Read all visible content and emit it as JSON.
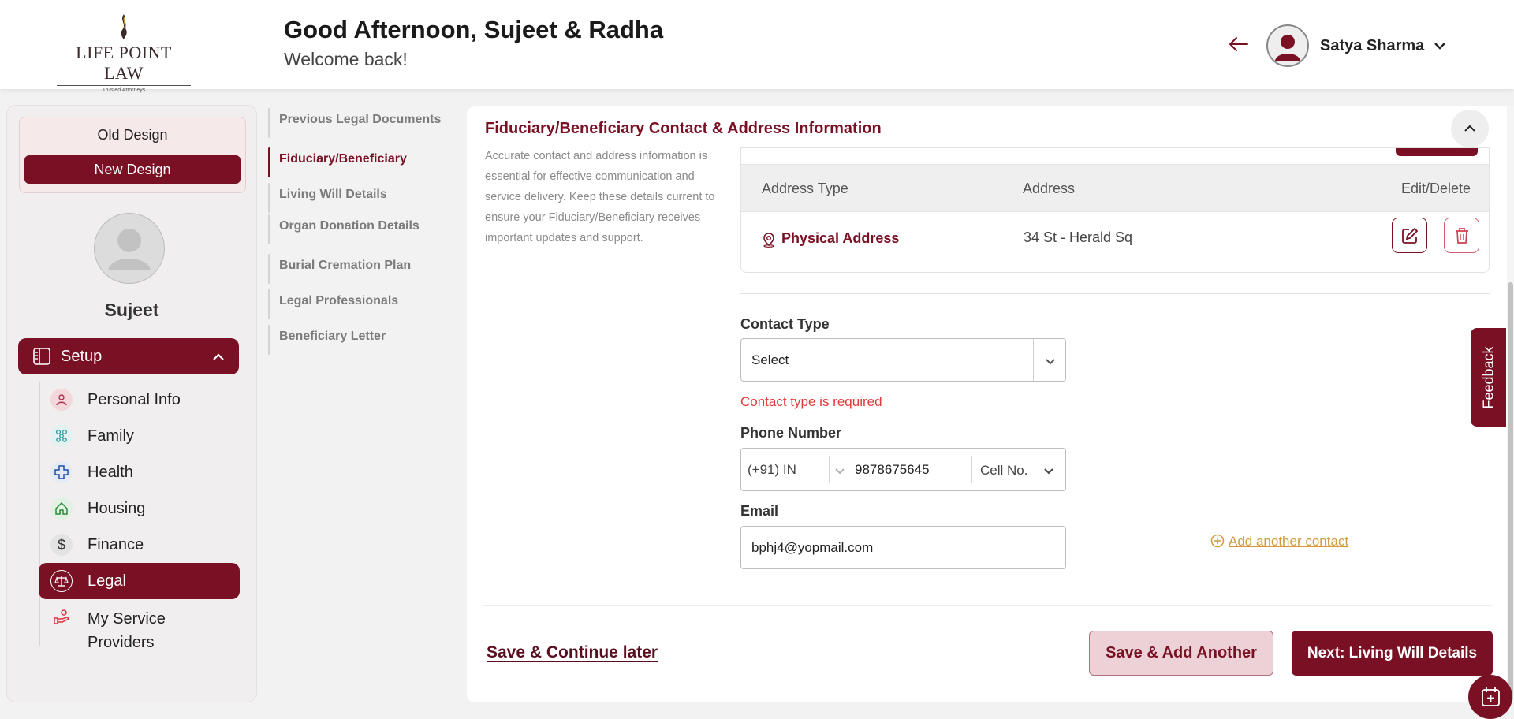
{
  "header": {
    "logo_name": "LIFE POINT LAW",
    "logo_tagline": "Trusted Attorneys",
    "greeting": "Good Afternoon, Sujeet & Radha",
    "welcome": "Welcome back!",
    "user_name": "Satya Sharma"
  },
  "sidebar": {
    "old_design": "Old Design",
    "new_design": "New Design",
    "profile_name": "Sujeet",
    "setup_label": "Setup",
    "items": [
      {
        "label": "Personal Info",
        "icon": "person-icon"
      },
      {
        "label": "Family",
        "icon": "family-icon"
      },
      {
        "label": "Health",
        "icon": "health-cross-icon"
      },
      {
        "label": "Housing",
        "icon": "home-icon"
      },
      {
        "label": "Finance",
        "icon": "dollar-icon"
      },
      {
        "label": "Legal",
        "icon": "scales-icon",
        "active": true
      },
      {
        "label": "My Service Providers",
        "icon": "service-hand-icon"
      }
    ]
  },
  "steps": [
    {
      "label": "Previous Legal Documents"
    },
    {
      "label": "Fiduciary/Beneficiary",
      "active": true
    },
    {
      "label": "Living Will Details"
    },
    {
      "label": "Organ Donation Details"
    },
    {
      "label": "Burial Cremation Plan"
    },
    {
      "label": "Legal Professionals"
    },
    {
      "label": "Beneficiary Letter"
    }
  ],
  "main": {
    "title": "Fiduciary/Beneficiary Contact & Address Information",
    "description": "Accurate contact and address information is essential for effective communication and service delivery. Keep these details current to ensure your Fiduciary/Beneficiary receives important updates and support.",
    "address_table": {
      "columns": [
        "Address Type",
        "Address",
        "Edit/Delete"
      ],
      "rows": [
        {
          "type": "Physical Address",
          "address": "34 St - Herald Sq"
        }
      ]
    },
    "contact_type": {
      "label": "Contact Type",
      "value": "Select",
      "error": "Contact type is required"
    },
    "phone": {
      "label": "Phone Number",
      "country_code": "(+91) IN",
      "number": "9878675645",
      "type": "Cell No."
    },
    "email": {
      "label": "Email",
      "value": "bphj4@yopmail.com"
    },
    "add_contact": "Add another contact",
    "save_later": "Save & Continue later",
    "save_add": "Save & Add Another",
    "next": "Next: Living Will Details"
  },
  "feedback_label": "Feedback",
  "colors": {
    "brand": "#7a1024",
    "error": "#e23a3a",
    "link": "#d19a3a"
  }
}
